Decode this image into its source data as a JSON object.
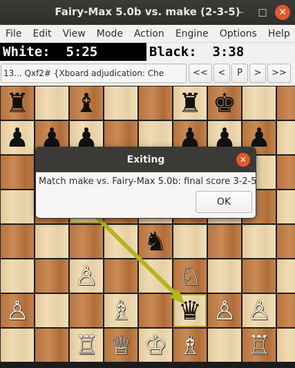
{
  "window": {
    "title": "Fairy-Max 5.0b vs. make (2-3-5)",
    "minimize": "–",
    "maximize": "□",
    "close": "✕"
  },
  "menu": [
    "File",
    "Edit",
    "View",
    "Mode",
    "Action",
    "Engine",
    "Options",
    "Help"
  ],
  "clocks": {
    "white": "White:  5:25",
    "black": "Black:  3:38"
  },
  "movebar": {
    "info": "13... Qxf2# {Xboard adjudication: Che",
    "buttons": [
      "<<",
      "<",
      "P",
      ">",
      ">>"
    ]
  },
  "board": {
    "pieces": [
      {
        "file": 0,
        "rank": 8,
        "glyph": "♜",
        "color": "b",
        "name": "black-rook-icon"
      },
      {
        "file": 2,
        "rank": 8,
        "glyph": "♝",
        "color": "b",
        "name": "black-bishop-icon"
      },
      {
        "file": 5,
        "rank": 8,
        "glyph": "♜",
        "color": "b",
        "name": "black-rook-icon"
      },
      {
        "file": 6,
        "rank": 8,
        "glyph": "♚",
        "color": "b",
        "name": "black-king-icon"
      },
      {
        "file": 0,
        "rank": 7,
        "glyph": "♟",
        "color": "b",
        "name": "black-pawn-icon"
      },
      {
        "file": 1,
        "rank": 7,
        "glyph": "♟",
        "color": "b",
        "name": "black-pawn-icon"
      },
      {
        "file": 2,
        "rank": 7,
        "glyph": "♟",
        "color": "b",
        "name": "black-pawn-icon"
      },
      {
        "file": 5,
        "rank": 7,
        "glyph": "♟",
        "color": "b",
        "name": "black-pawn-icon"
      },
      {
        "file": 6,
        "rank": 7,
        "glyph": "♟",
        "color": "b",
        "name": "black-pawn-icon"
      },
      {
        "file": 7,
        "rank": 7,
        "glyph": "♟",
        "color": "b",
        "name": "black-pawn-icon"
      },
      {
        "file": 4,
        "rank": 4,
        "glyph": "♞",
        "color": "b",
        "name": "black-knight-icon"
      },
      {
        "file": 2,
        "rank": 3,
        "glyph": "♙",
        "color": "w",
        "name": "white-pawn-icon"
      },
      {
        "file": 5,
        "rank": 3,
        "glyph": "♘",
        "color": "w",
        "name": "white-knight-icon"
      },
      {
        "file": 0,
        "rank": 2,
        "glyph": "♙",
        "color": "w",
        "name": "white-pawn-icon"
      },
      {
        "file": 3,
        "rank": 2,
        "glyph": "♗",
        "color": "w",
        "name": "white-bishop-icon"
      },
      {
        "file": 5,
        "rank": 2,
        "glyph": "♛",
        "color": "b",
        "name": "black-queen-icon"
      },
      {
        "file": 6,
        "rank": 2,
        "glyph": "♙",
        "color": "w",
        "name": "white-pawn-icon"
      },
      {
        "file": 7,
        "rank": 2,
        "glyph": "♙",
        "color": "w",
        "name": "white-pawn-icon"
      },
      {
        "file": 2,
        "rank": 1,
        "glyph": "♖",
        "color": "w",
        "name": "white-rook-icon"
      },
      {
        "file": 3,
        "rank": 1,
        "glyph": "♕",
        "color": "w",
        "name": "white-queen-icon"
      },
      {
        "file": 4,
        "rank": 1,
        "glyph": "♔",
        "color": "w",
        "name": "white-king-icon"
      },
      {
        "file": 5,
        "rank": 1,
        "glyph": "♗",
        "color": "w",
        "name": "white-bishop-icon"
      },
      {
        "file": 7,
        "rank": 1,
        "glyph": "♖",
        "color": "w",
        "name": "white-rook-icon"
      }
    ],
    "highlights": [
      {
        "file": 5,
        "rank": 2
      },
      {
        "file": 2,
        "rank": 5
      }
    ],
    "arrow_color": "#b5b31f"
  },
  "dialog": {
    "title": "Exiting",
    "message": "Match make vs. Fairy-Max 5.0b: final score 3-2-5",
    "ok": "OK"
  }
}
